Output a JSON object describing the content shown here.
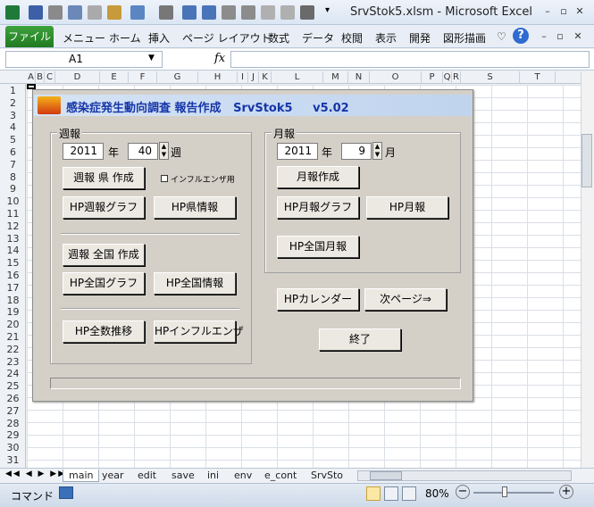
{
  "window": {
    "title": "SrvStok5.xlsm - Microsoft Excel"
  },
  "ribbon": {
    "file_tab": "ファイル",
    "tabs": [
      "メニュー",
      "ホーム",
      "挿入",
      "ページ レイアウト",
      "数式",
      "データ",
      "校閲",
      "表示",
      "開発",
      "図形描画"
    ]
  },
  "formula_bar": {
    "name_box": "A1",
    "fx": "fx"
  },
  "columns": [
    "A",
    "B",
    "C",
    "D",
    "E",
    "F",
    "G",
    "H",
    "I",
    "J",
    "K",
    "L",
    "M",
    "N",
    "O",
    "P",
    "Q",
    "R",
    "S",
    "T"
  ],
  "rows": [
    "1",
    "2",
    "3",
    "4",
    "5",
    "6",
    "7",
    "8",
    "9",
    "10",
    "11",
    "12",
    "13",
    "14",
    "15",
    "16",
    "17",
    "18",
    "19",
    "20",
    "21",
    "22",
    "23",
    "24",
    "25",
    "26",
    "27",
    "28",
    "29",
    "30",
    "31"
  ],
  "dialog": {
    "title": "感染症発生動向調査 報告作成   SrvStok5     v5.02",
    "weekly": {
      "label": "週報",
      "year": "2011",
      "year_unit": "年",
      "week": "40",
      "week_unit": "週",
      "create_pref_button": "週報 県 作成",
      "influenza_checkbox": "インフルエンザ用",
      "hp_weekly_graph_button": "HP週報グラフ",
      "hp_pref_info_button": "HP県情報",
      "create_national_button": "週報 全国 作成",
      "hp_national_graph_button": "HP全国グラフ",
      "hp_national_info_button": "HP全国情報",
      "hp_total_trend_button": "HP全数推移",
      "hp_influenza_button": "HPインフルエンザ"
    },
    "monthly": {
      "label": "月報",
      "year": "2011",
      "year_unit": "年",
      "month": "9",
      "month_unit": "月",
      "create_button": "月報作成",
      "hp_monthly_graph_button": "HP月報グラフ",
      "hp_monthly_button": "HP月報",
      "hp_national_monthly_button": "HP全国月報"
    },
    "hp_calendar_button": "HPカレンダー",
    "next_page_button": "次ページ⇒",
    "exit_button": "終了"
  },
  "sheet_tabs": [
    "main",
    "year",
    "edit",
    "save",
    "ini",
    "env",
    "e_cont",
    "SrvSto"
  ],
  "status": {
    "mode": "コマンド",
    "zoom": "80%"
  }
}
